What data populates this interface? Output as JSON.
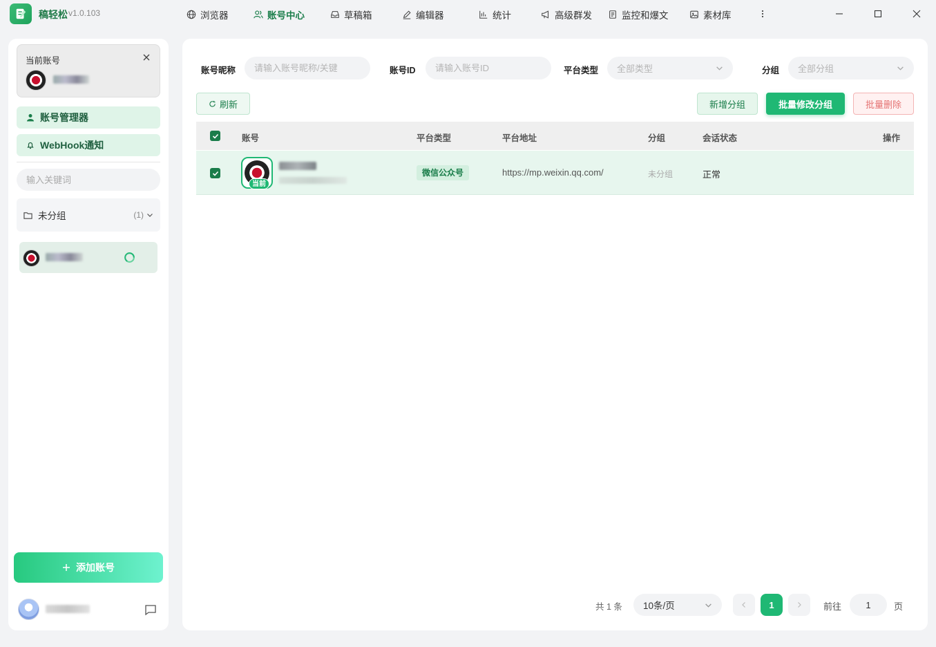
{
  "app": {
    "name": "稿轻松",
    "version": "v1.0.103"
  },
  "nav": {
    "items": [
      {
        "label": "浏览器",
        "icon": "globe-icon"
      },
      {
        "label": "账号中心",
        "icon": "users-icon",
        "active": true
      },
      {
        "label": "草稿箱",
        "icon": "inbox-icon"
      },
      {
        "label": "编辑器",
        "icon": "pen-icon"
      },
      {
        "label": "统计",
        "icon": "bar-chart-icon"
      },
      {
        "label": "高级群发",
        "icon": "megaphone-icon"
      },
      {
        "label": "监控和爆文",
        "icon": "document-icon"
      },
      {
        "label": "素材库",
        "icon": "image-icon"
      }
    ],
    "more_icon": "more-vertical-icon"
  },
  "window": {
    "controls": [
      "minimize-icon",
      "maximize-icon",
      "close-icon"
    ]
  },
  "sidebar": {
    "current_account_label": "当前账号",
    "menu": {
      "account_manager": "账号管理器",
      "webhook": "WebHook通知"
    },
    "search_placeholder": "输入关键词",
    "group": {
      "name": "未分组",
      "count": "(1)"
    },
    "add_button": "添加账号"
  },
  "filters": {
    "nickname_label": "账号昵称",
    "nickname_placeholder": "请输入账号昵称/关键",
    "id_label": "账号ID",
    "id_placeholder": "请输入账号ID",
    "platform_label": "平台类型",
    "platform_value": "全部类型",
    "group_label": "分组",
    "group_value": "全部分组"
  },
  "toolbar": {
    "refresh": "刷新",
    "new_group": "新增分组",
    "batch_group": "批量修改分组",
    "batch_delete": "批量删除"
  },
  "table": {
    "headers": {
      "account": "账号",
      "platform": "平台类型",
      "url": "平台地址",
      "group": "分组",
      "status": "会话状态",
      "action": "操作"
    },
    "rows": [
      {
        "current_tag": "当前",
        "platform": "微信公众号",
        "url": "https://mp.weixin.qq.com/",
        "group": "未分组",
        "status": "正常"
      }
    ]
  },
  "pagination": {
    "total": "共 1 条",
    "page_size": "10条/页",
    "current_page": "1",
    "goto_label": "前往",
    "goto_value": "1",
    "page_suffix": "页"
  },
  "colors": {
    "accent": "#1fb874",
    "accent_dark": "#1a7d4a",
    "danger": "#e57373"
  }
}
